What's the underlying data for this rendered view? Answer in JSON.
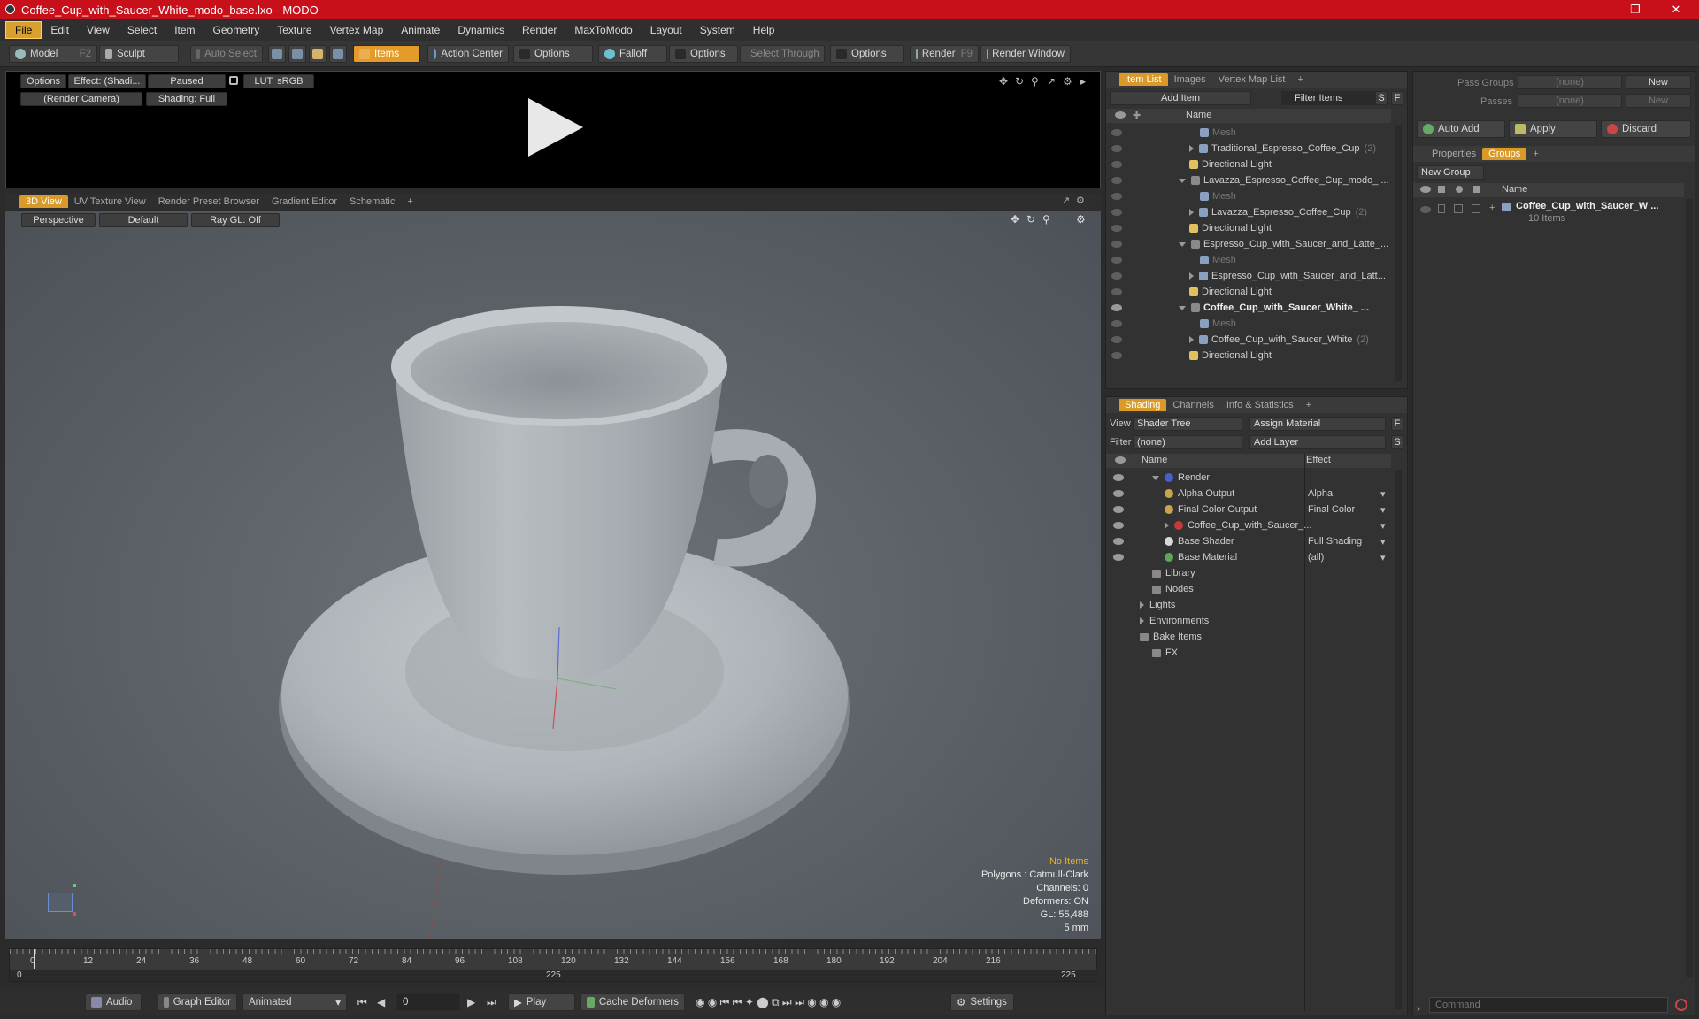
{
  "title": "Coffee_Cup_with_Saucer_White_modo_base.lxo - MODO",
  "menu": [
    "File",
    "Edit",
    "View",
    "Select",
    "Item",
    "Geometry",
    "Texture",
    "Vertex Map",
    "Animate",
    "Dynamics",
    "Render",
    "MaxToModo",
    "Layout",
    "System",
    "Help"
  ],
  "toolbar": {
    "model": "Model",
    "model_key": "F2",
    "sculpt": "Sculpt",
    "auto_select": "Auto Select",
    "items": "Items",
    "action_center": "Action Center",
    "options1": "Options",
    "falloff": "Falloff",
    "options2": "Options",
    "select_through": "Select Through",
    "options3": "Options",
    "render": "Render",
    "render_key": "F9",
    "render_window": "Render Window"
  },
  "preview": {
    "options": "Options",
    "effect": "Effect: (Shadi...",
    "paused": "Paused",
    "lut": "LUT: sRGB",
    "camera": "(Render Camera)",
    "shading": "Shading: Full"
  },
  "viewport_tabs": [
    "3D View",
    "UV Texture View",
    "Render Preset Browser",
    "Gradient Editor",
    "Schematic",
    "+"
  ],
  "viewport": {
    "perspective": "Perspective",
    "default": "Default",
    "raygl": "Ray GL: Off",
    "info": {
      "no_items": "No Items",
      "polygons": "Polygons : Catmull-Clark",
      "channels": "Channels: 0",
      "deformers": "Deformers: ON",
      "gl": "GL: 55,488",
      "unit": "5 mm"
    }
  },
  "timeline": {
    "ticks": [
      "0",
      "12",
      "24",
      "36",
      "48",
      "60",
      "72",
      "84",
      "96",
      "108",
      "120",
      "132",
      "144",
      "156",
      "168",
      "180",
      "192",
      "204",
      "216"
    ],
    "start": "0",
    "mid": "225",
    "end": "225"
  },
  "bottom": {
    "audio": "Audio",
    "graph_editor": "Graph Editor",
    "animated": "Animated",
    "frame": "0",
    "play": "Play",
    "cache_deformers": "Cache Deformers",
    "settings": "Settings"
  },
  "item_list": {
    "tabs": [
      "Item List",
      "Images",
      "Vertex Map List",
      "+"
    ],
    "add_item": "Add Item",
    "filter_items": "Filter Items",
    "s": "S",
    "f": "F",
    "col_name": "Name",
    "rows": [
      {
        "label": "Mesh",
        "indent": 3,
        "dim": true
      },
      {
        "label": "Traditional_Espresso_Coffee_Cup",
        "suffix": "(2)",
        "indent": 2,
        "arrow": "r"
      },
      {
        "label": "Directional Light",
        "indent": 2
      },
      {
        "label": "Lavazza_Espresso_Coffee_Cup_modo_ ...",
        "indent": 1,
        "arrow": "d"
      },
      {
        "label": "Mesh",
        "indent": 3,
        "dim": true
      },
      {
        "label": "Lavazza_Espresso_Coffee_Cup",
        "suffix": "(2)",
        "indent": 2,
        "arrow": "r"
      },
      {
        "label": "Directional Light",
        "indent": 2
      },
      {
        "label": "Espresso_Cup_with_Saucer_and_Latte_...",
        "indent": 1,
        "arrow": "d"
      },
      {
        "label": "Mesh",
        "indent": 3,
        "dim": true
      },
      {
        "label": "Espresso_Cup_with_Saucer_and_Latt...",
        "indent": 2,
        "arrow": "r"
      },
      {
        "label": "Directional Light",
        "indent": 2
      },
      {
        "label": "Coffee_Cup_with_Saucer_White_ ...",
        "indent": 1,
        "arrow": "d",
        "bold": true
      },
      {
        "label": "Mesh",
        "indent": 3,
        "dim": true
      },
      {
        "label": "Coffee_Cup_with_Saucer_White",
        "suffix": "(2)",
        "indent": 2,
        "arrow": "r"
      },
      {
        "label": "Directional Light",
        "indent": 2
      }
    ]
  },
  "shading": {
    "tabs": [
      "Shading",
      "Channels",
      "Info & Statistics",
      "+"
    ],
    "view_label": "View",
    "view_value": "Shader Tree",
    "assign_material": "Assign Material",
    "f": "F",
    "filter_label": "Filter",
    "filter_value": "(none)",
    "add_layer": "Add Layer",
    "s": "S",
    "col_name": "Name",
    "col_effect": "Effect",
    "rows": [
      {
        "label": "Render",
        "effect": "",
        "indent": 0,
        "arrow": "d",
        "color": "#4a5ec8"
      },
      {
        "label": "Alpha Output",
        "effect": "Alpha",
        "indent": 1,
        "color": "#c9a44a"
      },
      {
        "label": "Final Color Output",
        "effect": "Final Color",
        "indent": 1,
        "color": "#c9a44a"
      },
      {
        "label": "Coffee_Cup_with_Saucer_...",
        "effect": "",
        "indent": 1,
        "arrow": "r",
        "color": "#c83a3a"
      },
      {
        "label": "Base Shader",
        "effect": "Full Shading",
        "indent": 1,
        "color": "#d8d8d8"
      },
      {
        "label": "Base Material",
        "effect": "(all)",
        "indent": 1,
        "color": "#5aa85a"
      },
      {
        "label": "Library",
        "effect": "",
        "indent": 0
      },
      {
        "label": "Nodes",
        "effect": "",
        "indent": 0
      },
      {
        "label": "Lights",
        "effect": "",
        "indent": -1,
        "arrow": "r"
      },
      {
        "label": "Environments",
        "effect": "",
        "indent": -1,
        "arrow": "r"
      },
      {
        "label": "Bake Items",
        "effect": "",
        "indent": -1
      },
      {
        "label": "FX",
        "effect": "",
        "indent": 0
      }
    ]
  },
  "right": {
    "pass_groups": "Pass Groups",
    "passes": "Passes",
    "none": "(none)",
    "new": "New",
    "auto_add": "Auto Add",
    "apply": "Apply",
    "discard": "Discard",
    "tabs": [
      "Properties",
      "Groups",
      "+"
    ],
    "new_group": "New Group",
    "col_name": "Name",
    "group_name": "Coffee_Cup_with_Saucer_W ...",
    "group_count": "10 Items",
    "command_placeholder": "Command"
  },
  "colors": {
    "accent": "#e59b2a",
    "title": "#c8101a"
  }
}
